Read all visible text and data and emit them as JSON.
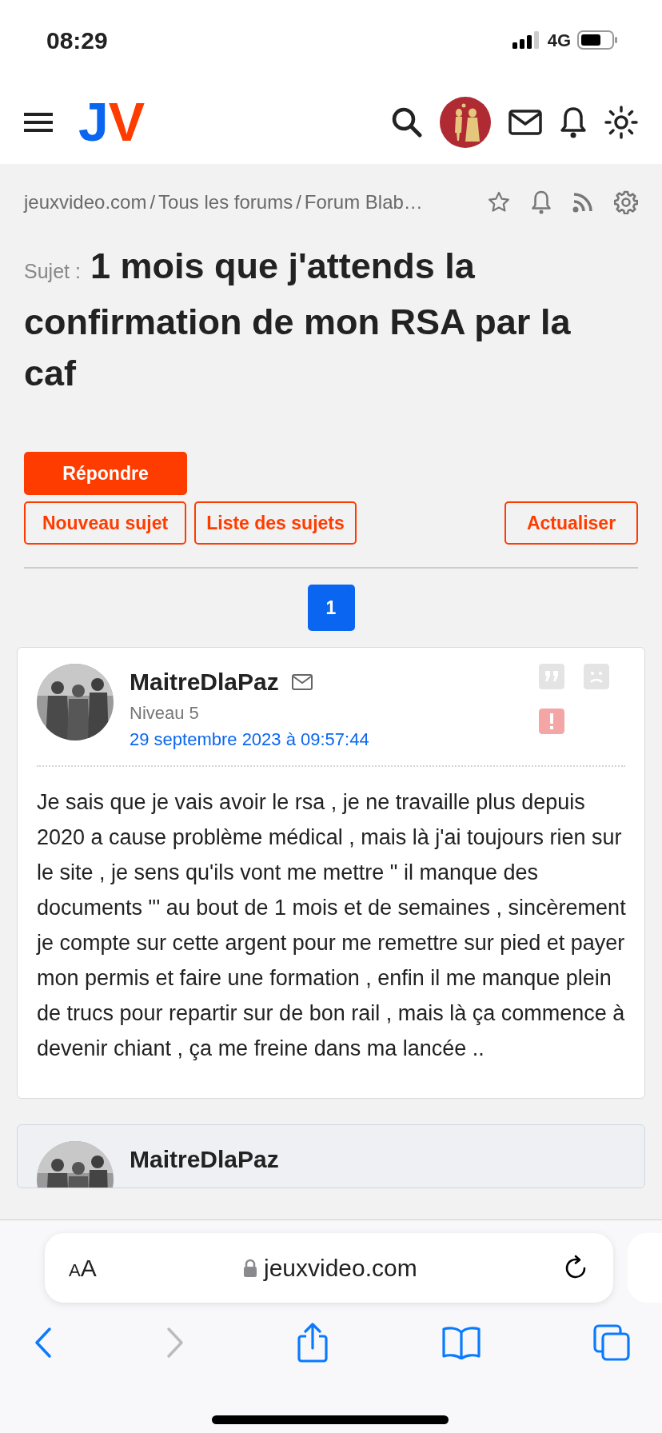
{
  "status_bar": {
    "time": "08:29",
    "network": "4G"
  },
  "header": {
    "logo": [
      {
        "text": "J",
        "color": "#0a66f0"
      },
      {
        "text": "V",
        "color": "#ff3c00"
      }
    ]
  },
  "breadcrumb": {
    "separator": "/",
    "items": [
      {
        "label": "jeuxvideo.com"
      },
      {
        "label": "Tous les forums"
      },
      {
        "label": "Forum Blab…"
      }
    ]
  },
  "topic": {
    "prefix": "Sujet :",
    "title": "1 mois que j'attends la confirmation de mon RSA par la caf"
  },
  "actions": {
    "reply": "Répondre",
    "links": [
      "Nouveau sujet",
      "Liste des sujets"
    ],
    "refresh": "Actualiser"
  },
  "pagination": [
    {
      "label": "1",
      "selected": true
    }
  ],
  "posts": [
    {
      "author": "MaitreDlaPaz",
      "level": "Niveau 5",
      "date": "29 septembre 2023 à 09:57:44",
      "body": "Je sais que je vais avoir le rsa , je ne travaille plus depuis 2020 a cause problème médical , mais là j'ai toujours rien sur le site , je sens qu'ils vont me mettre \" il manque des documents \"' au bout de 1 mois et de semaines , sincèrement je compte sur cette argent pour me remettre sur pied et payer mon permis et faire une formation , enfin il me manque plein de trucs pour repartir sur de bon rail , mais là ça commence à devenir chiant , ça me freine dans ma lancée .."
    },
    {
      "author": "MaitreDlaPaz"
    }
  ],
  "browser": {
    "text_size": "AA",
    "url": "jeuxvideo.com"
  }
}
